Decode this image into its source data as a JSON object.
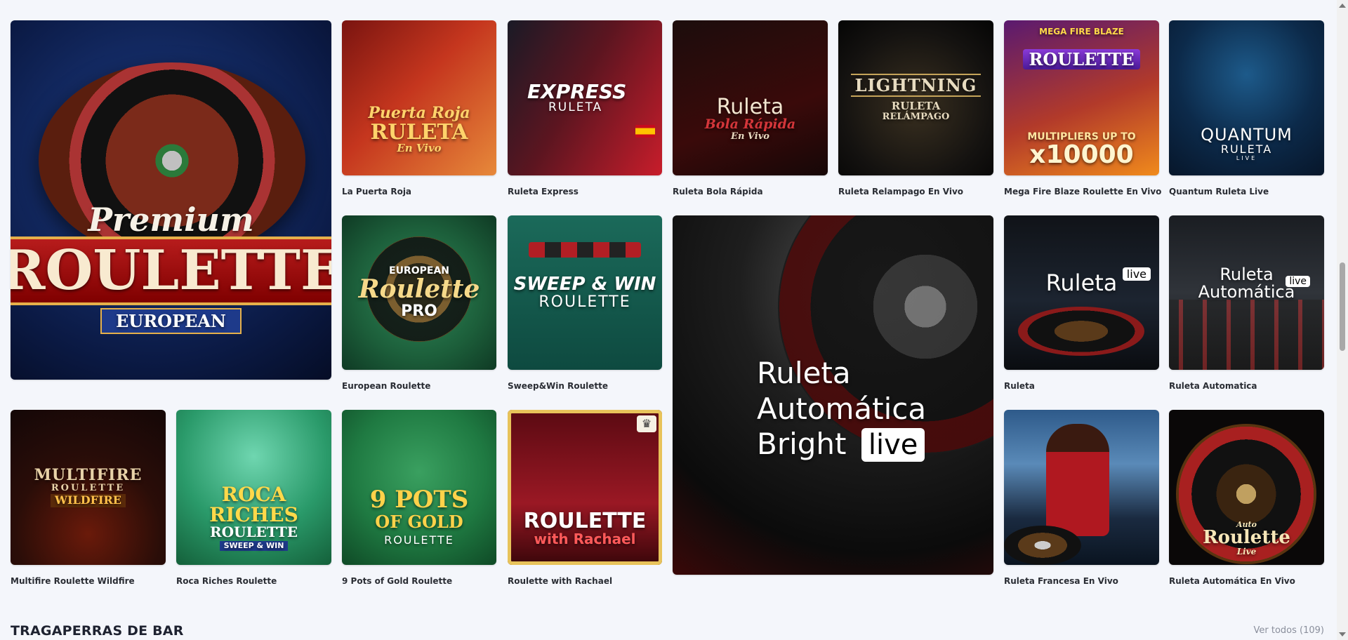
{
  "games": [
    {
      "name": "Premium Roulette European",
      "art_lines": [
        "Premium",
        "ROULETTE",
        "EUROPEAN"
      ]
    },
    {
      "name": "La Puerta Roja",
      "art_lines": [
        "Puerta Roja",
        "RULETA",
        "En Vivo"
      ]
    },
    {
      "name": "Ruleta Express",
      "art_lines": [
        "EXPRESS",
        "RULETA"
      ]
    },
    {
      "name": "Ruleta Bola Rápida",
      "art_lines": [
        "Ruleta",
        "Bola Rápida",
        "En Vivo"
      ]
    },
    {
      "name": "Ruleta Relampago En Vivo",
      "art_lines": [
        "LIGHTNING",
        "RULETA",
        "RELÁMPAGO"
      ]
    },
    {
      "name": "Mega Fire Blaze Roulette En Vivo",
      "art_lines": [
        "MEGA FIRE BLAZE",
        "ROULETTE",
        "MULTIPLIERS UP TO",
        "x10000"
      ]
    },
    {
      "name": "Quantum Ruleta Live",
      "art_lines": [
        "QUANTUM",
        "RULETA",
        "LIVE"
      ]
    },
    {
      "name": "European Roulette",
      "art_lines": [
        "EUROPEAN",
        "Roulette",
        "PRO"
      ]
    },
    {
      "name": "Sweep&Win Roulette",
      "art_lines": [
        "SWEEP & WIN",
        "ROULETTE"
      ]
    },
    {
      "name": "Ruleta Automática Bright",
      "art_lines": [
        "Ruleta",
        "Automática",
        "Bright"
      ],
      "badge": "live"
    },
    {
      "name": "Ruleta",
      "art_lines": [
        "Ruleta"
      ],
      "badge": "live"
    },
    {
      "name": "Ruleta Automatica",
      "art_lines": [
        "Ruleta",
        "Automática"
      ],
      "badge": "live"
    },
    {
      "name": "Multifire Roulette Wildfire",
      "art_lines": [
        "MULTIFIRE",
        "ROULETTE",
        "WILDFIRE"
      ]
    },
    {
      "name": "Roca Riches Roulette",
      "art_lines": [
        "ROCA",
        "RICHES",
        "ROULETTE",
        "SWEEP & WIN"
      ]
    },
    {
      "name": "9 Pots of Gold Roulette",
      "art_lines": [
        "9 POTS",
        "OF GOLD",
        "ROULETTE"
      ]
    },
    {
      "name": "Roulette with Rachael",
      "art_lines": [
        "ROULETTE",
        "with Rachael"
      ]
    },
    {
      "name": "Ruleta Francesa En Vivo",
      "art_lines": []
    },
    {
      "name": "Ruleta Automática En Vivo",
      "art_lines": [
        "Auto",
        "Roulette",
        "Live"
      ]
    }
  ],
  "captions": {
    "puerta_roja": "La Puerta Roja",
    "express": "Ruleta Express",
    "bola": "Ruleta Bola Rápida",
    "relampago": "Ruleta Relampago En Vivo",
    "megafire": "Mega Fire Blaze Roulette En Vivo",
    "quantum": "Quantum Ruleta Live",
    "european": "European Roulette",
    "sweepwin": "Sweep&Win Roulette",
    "ruleta": "Ruleta",
    "ruleta_auto": "Ruleta Automatica",
    "multifire": "Multifire Roulette Wildfire",
    "roca": "Roca Riches Roulette",
    "pots": "9 Pots of Gold Roulette",
    "rachael": "Roulette with Rachael",
    "francesa": "Ruleta Francesa En Vivo",
    "auto_vivo": "Ruleta Automática En Vivo"
  },
  "section": {
    "title": "TRAGAPERRAS DE BAR",
    "view_all": "Ver todos (109)"
  },
  "colors": {
    "page_bg": "#f4f6fb",
    "caption_text": "#2a2d34",
    "view_all_text": "#8a8f9c"
  }
}
